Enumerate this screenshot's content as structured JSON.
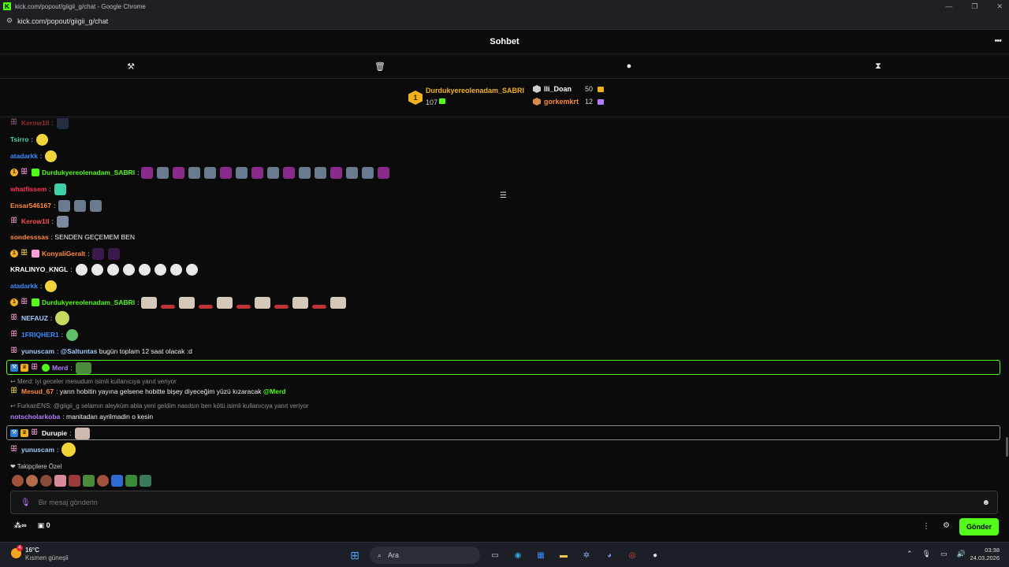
{
  "window": {
    "title": "kick.com/popout/giigii_g/chat - Google Chrome",
    "url": "kick.com/popout/giigii_g/chat"
  },
  "header": {
    "title": "Sohbet"
  },
  "leaderboard": {
    "first": {
      "rank": "1",
      "name": "Durdukyereolenadam_SABRI",
      "count": "107"
    },
    "second": {
      "name": "lli_Doan",
      "count": "50"
    },
    "third": {
      "name": "gorkemkrt",
      "count": "12"
    }
  },
  "messages": [
    {
      "user": "Kerow1ll",
      "sep": ":",
      "text": "",
      "color": "#ff4d4d"
    },
    {
      "user": "Tsirro",
      "sep": ":",
      "text": "",
      "color": "#4dd0a8"
    },
    {
      "user": "atadarkk",
      "sep": ":",
      "text": "",
      "color": "#3d8bff"
    },
    {
      "user": "Durdukyereolenadam_SABRI",
      "sep": ":",
      "text": "",
      "color": "#53fc18"
    },
    {
      "user": "whatfissem",
      "sep": ":",
      "text": "",
      "color": "#ff3355"
    },
    {
      "user": "Ensar546167",
      "sep": ":",
      "text": "",
      "color": "#ff8a3d"
    },
    {
      "user": "Kerow1ll",
      "sep": ":",
      "text": "",
      "color": "#ff4d4d"
    },
    {
      "user": "sondesssas",
      "sep": ":",
      "text": "SENDEN GEÇEMEM BEN",
      "color": "#ff8a3d"
    },
    {
      "user": "KonyaliGeralt",
      "sep": ":",
      "text": "",
      "color": "#ff8a3d"
    },
    {
      "user": "KRALINYO_KNGL",
      "sep": ":",
      "text": "",
      "color": "#ffffff"
    },
    {
      "user": "atadarkk",
      "sep": ":",
      "text": "",
      "color": "#3d8bff"
    },
    {
      "user": "Durdukyereolenadam_SABRI",
      "sep": ":",
      "text": "",
      "color": "#53fc18"
    },
    {
      "user": "NEFAUZ",
      "sep": ":",
      "text": "",
      "color": "#9ecbff"
    },
    {
      "user": "1FRIQHER1",
      "sep": ":",
      "text": "",
      "color": "#3d8bff"
    },
    {
      "user": "yunuscam",
      "sep": ":",
      "text": "bugün toplam 12 saat olacak :d",
      "mention": "@Saltuntas",
      "color": "#9ecbff"
    },
    {
      "user": "Merd",
      "sep": ":",
      "text": "",
      "color": "#b57cff"
    }
  ],
  "reply1": {
    "context": "Merd: iyi geceler mesudum isimli kullanıcıya yanıt veriyor",
    "user": "Mesud_67",
    "sep": ":",
    "text": "yarın hobitin yayına gelsene hobitte bişey diyeceğim yüzü kızaracak",
    "mention": "@Merd"
  },
  "reply2": {
    "context": "FurkanENS: @giigii_g selamın aleyküm abla yeni geldim nasılsın ben kötü isimli kullanıcıya yanıt veriyor",
    "user": "notscholarkoba",
    "sep": ":",
    "text": "manitadan ayrilmadin o kesin"
  },
  "msg_durupie": {
    "user": "Durupie",
    "sep": ":"
  },
  "msg_last": {
    "user": "yunuscam",
    "sep": ":"
  },
  "followers": {
    "label": "Takipçilere Özel"
  },
  "input": {
    "placeholder": "Bir mesaj gönderin"
  },
  "footer": {
    "infinity": "∞",
    "gift_count": "0",
    "send_label": "Gönder"
  },
  "taskbar": {
    "temp": "16°C",
    "weather": "Kısmen güneşli",
    "search": "Ara",
    "time": "03:38",
    "date": "24.03.2026",
    "notif": "4"
  },
  "colors": {
    "accent": "#53fc18",
    "gold": "#f2b01e",
    "bg": "#0b0b0c"
  }
}
